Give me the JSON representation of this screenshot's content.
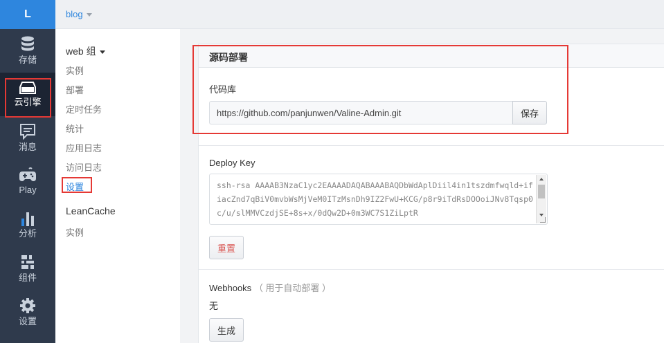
{
  "nav": {
    "logo": "L",
    "items": [
      {
        "label": "存储",
        "icon": "database-icon"
      },
      {
        "label": "云引擎",
        "icon": "cloud-engine-icon"
      },
      {
        "label": "消息",
        "icon": "message-icon"
      },
      {
        "label": "Play",
        "icon": "gamepad-icon"
      },
      {
        "label": "分析",
        "icon": "bar-chart-icon"
      },
      {
        "label": "组件",
        "icon": "components-icon"
      },
      {
        "label": "设置",
        "icon": "gear-icon"
      }
    ]
  },
  "topbar": {
    "app_name": "blog"
  },
  "subnav": {
    "group1_title": "web 组",
    "group1_items": [
      "实例",
      "部署",
      "定时任务",
      "统计",
      "应用日志",
      "访问日志",
      "设置"
    ],
    "group2_title": "LeanCache",
    "group2_items": [
      "实例"
    ]
  },
  "main": {
    "section_title": "源码部署",
    "repo_label": "代码库",
    "repo_value": "https://github.com/panjunwen/Valine-Admin.git",
    "save_label": "保存",
    "deploy_key_label": "Deploy Key",
    "deploy_key_value": "ssh-rsa AAAAB3NzaC1yc2EAAAADAQABAAABAQDbWdAplDiil4in1tszdmfwqld+ifiacZnd7qBiV0mvbWsMjVeM0ITzMsnDh9IZ2FwU+KCG/p8r9iTdRsDOOoiJNv8Tqsp0c/u/slMMVCzdjSE+8s+x/0dQw2D+0m3WC7S1ZiLptR",
    "reset_label": "重置",
    "webhooks_label": "Webhooks",
    "webhooks_note": "（ 用于自动部署 ）",
    "webhooks_value": "无",
    "generate_label": "生成"
  },
  "colors": {
    "accent": "#2e86de",
    "nav_bg": "#2f3a4c",
    "highlight_box": "#e53935",
    "danger_text": "#d9534f"
  }
}
